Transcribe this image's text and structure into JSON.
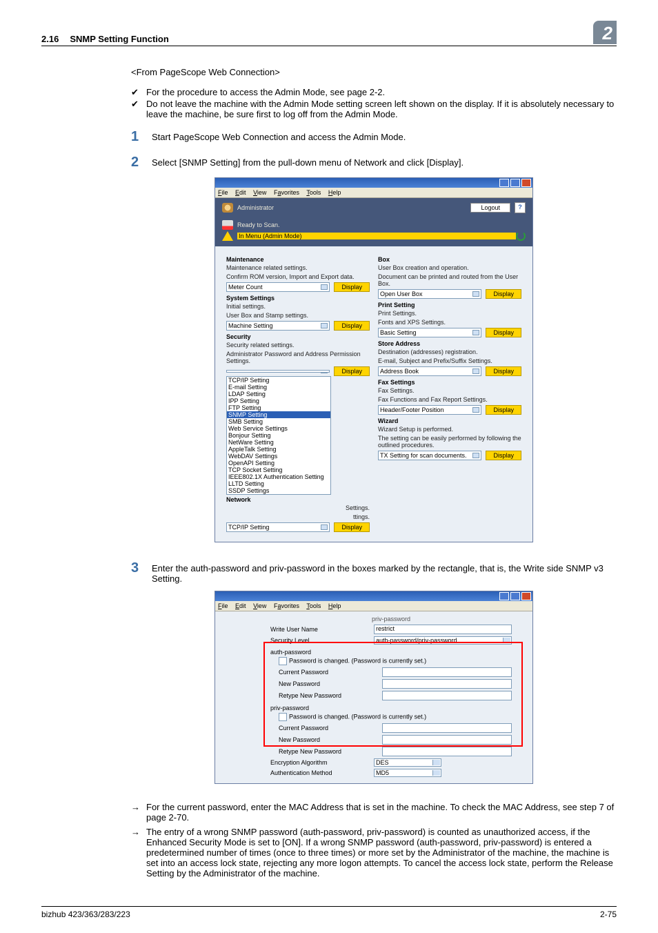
{
  "header": {
    "num": "2.16",
    "title": "SNMP Setting Function",
    "big": "2"
  },
  "lead": "<From PageScope Web Connection>",
  "chk": [
    "For the procedure to access the Admin Mode, see page 2-2.",
    "Do not leave the machine with the Admin Mode setting screen left shown on the display. If it is absolutely necessary to leave the machine, be sure first to log off from the Admin Mode."
  ],
  "step1": "Start PageScope Web Connection and access the Admin Mode.",
  "step2": "Select [SNMP Setting] from the pull-down menu of Network and click [Display].",
  "step3": "Enter the auth-password and priv-password in the boxes marked by the rectangle, that is, the Write side SNMP v3 Setting.",
  "menu": {
    "file": "File",
    "edit": "Edit",
    "view": "View",
    "fav": "Favorites",
    "tools": "Tools",
    "help": "Help"
  },
  "admin": {
    "label": "Administrator",
    "logout": "Logout"
  },
  "status": {
    "ready": "Ready to Scan.",
    "mode": "In Menu (Admin Mode)"
  },
  "btn_display": "Display",
  "s1": {
    "maint_t": "Maintenance",
    "maint_d1": "Maintenance related settings.",
    "maint_d2": "Confirm ROM version, Import and Export data.",
    "maint_sel": "Meter Count",
    "box_t": "Box",
    "box_d1": "User Box creation and operation.",
    "box_d2": "Document can be printed and routed from the User Box.",
    "box_sel": "Open User Box",
    "sys_t": "System Settings",
    "sys_d1": "Initial settings.",
    "sys_d2": "User Box and Stamp settings.",
    "sys_sel": "Machine Setting",
    "prn_t": "Print Setting",
    "prn_d1": "Print Settings.",
    "prn_d2": "Fonts and XPS Settings.",
    "prn_sel": "Basic Setting",
    "sec_t": "Security",
    "sec_d1": "Security related settings.",
    "sec_d2": "Administrator Password and Address Permission Settings.",
    "store_t": "Store Address",
    "store_d1": "Destination (addresses) registration.",
    "store_d2": "E-mail, Subject and Prefix/Suffix Settings.",
    "store_sel": "Address Book",
    "net_t": "Network",
    "net_d1": "Network related settings.",
    "net_d2": "Protocol Settings.",
    "net_sel": "TCP/IP Setting",
    "fax_t": "Fax Settings",
    "fax_d1": "Fax Settings.",
    "fax_d2": "Fax Functions and Fax Report Settings.",
    "fax_sel": "Header/Footer Position",
    "wiz_t": "Wizard",
    "wiz_d1": "Wizard Setup is performed.",
    "wiz_d2": "The setting can be easily performed by following the outlined procedures.",
    "wiz_sel": "TX Setting for scan documents.",
    "dd": [
      "TCP/IP Setting",
      "E-mail Setting",
      "LDAP Setting",
      "IPP Setting",
      "FTP Setting",
      "SNMP Setting",
      "SMB Setting",
      "Web Service Settings",
      "Bonjour Setting",
      "NetWare Setting",
      "AppleTalk Setting",
      "WebDAV Settings",
      "OpenAPI Setting",
      "TCP Socket Setting",
      "IEEE802.1X Authentication Setting",
      "LLTD Setting",
      "SSDP Settings"
    ],
    "dd_sufA": "Settings.",
    "dd_sufB": "ttings."
  },
  "s2": {
    "top": "priv-password",
    "wun": "Write User Name",
    "wun_v": "restrict",
    "slvl": "Security Level",
    "slvl_v": "auth-password/priv-password",
    "ap": "auth-password",
    "pc": "Password is changed. (Password is currently set.)",
    "cp": "Current Password",
    "np": "New Password",
    "rnp": "Retype New Password",
    "pp": "priv-password",
    "ea": "Encryption Algorithm",
    "ea_v": "DES",
    "am": "Authentication Method",
    "am_v": "MD5"
  },
  "arrows": [
    "For the current password, enter the MAC Address that is set in the machine. To check the MAC Address, see step 7 of page 2-70.",
    "The entry of a wrong SNMP password (auth-password, priv-password) is counted as unauthorized access, if the Enhanced Security Mode is set to [ON]. If a wrong SNMP password (auth-password, priv-password) is entered a predetermined number of times (once to three times) or more set by the Administrator of the machine, the machine is set into an access lock state, rejecting any more logon attempts. To cancel the access lock state, perform the Release Setting by the Administrator of the machine."
  ],
  "footer": {
    "left": "bizhub 423/363/283/223",
    "right": "2-75"
  }
}
